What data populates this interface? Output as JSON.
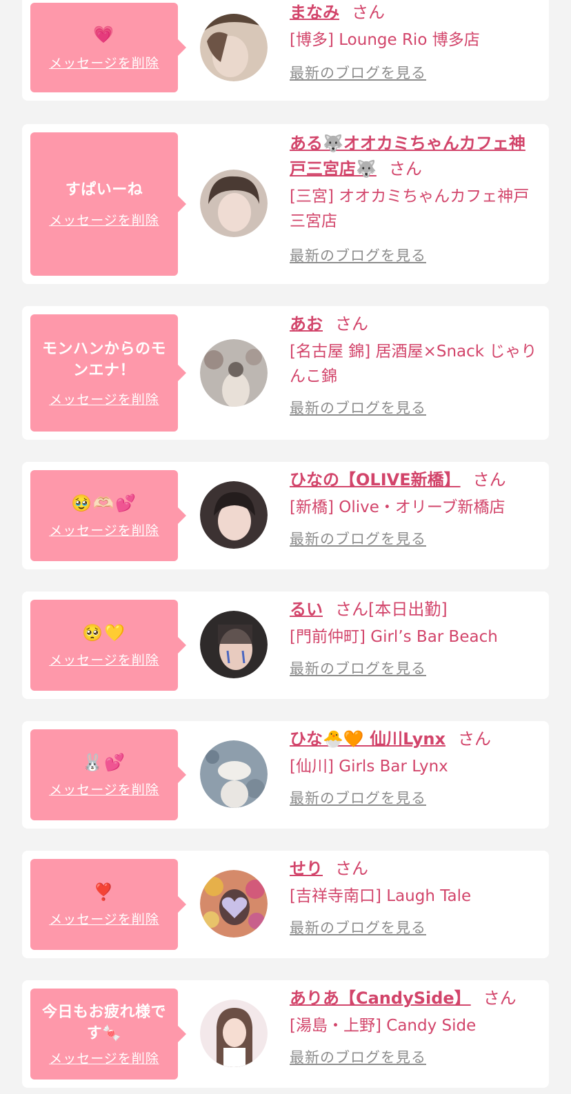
{
  "common": {
    "delete_label": "メッセージを削除",
    "blog_label": "最新のブログを見る",
    "honorific": "さん"
  },
  "entries": [
    {
      "message": "💗",
      "name": "まなみ",
      "shop": "[博多] Lounge Rio 博多店",
      "avatar_colors": [
        "#d8c7b8",
        "#5a4638"
      ]
    },
    {
      "message": "すぱいーね",
      "name": "ある🐺オオカミちゃんカフェ神戸三宮店🐺",
      "shop": "[三宮] オオカミちゃんカフェ神戸三宮店",
      "avatar_colors": [
        "#cfc1b8",
        "#4a3a33"
      ]
    },
    {
      "message": "モンハンからのモンエナ！",
      "name": "あお",
      "shop": "[名古屋 錦] 居酒屋×Snack じゃりんこ錦",
      "avatar_colors": [
        "#bdb7b2",
        "#6e6560"
      ]
    },
    {
      "message": "🥹🫶🏻💕",
      "name": "ひなの【OLIVE新橋】",
      "shop": "[新橋] Olive・オリーブ新橋店",
      "avatar_colors": [
        "#3c3232",
        "#c9aba0"
      ]
    },
    {
      "message": "🥺💛",
      "name": "るい",
      "tag": "[本日出勤]",
      "shop": "[門前仲町] Girl’s Bar Beach",
      "avatar_colors": [
        "#2e2a2a",
        "#d9b9ad"
      ]
    },
    {
      "message": "🐰💕",
      "name": "ひな🐣🧡 仙川Lynx",
      "shop": "[仙川] Girls Bar Lynx",
      "avatar_colors": [
        "#8e9eac",
        "#e9e6e2"
      ]
    },
    {
      "message": "❣️",
      "name": "せり",
      "shop": "[吉祥寺南口] Laugh Tale",
      "avatar_colors": [
        "#d58a6a",
        "#c9c0e8"
      ]
    },
    {
      "message": "今日もお疲れ様です🍬",
      "name": "ありあ【CandySide】",
      "shop": "[湯島・上野] Candy Side",
      "avatar_colors": [
        "#f3e8ea",
        "#6b4f45"
      ]
    }
  ]
}
